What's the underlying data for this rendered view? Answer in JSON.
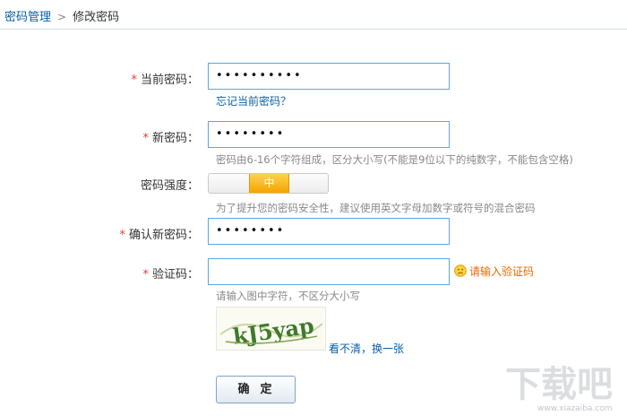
{
  "breadcrumb": {
    "parent": "密码管理",
    "current": "修改密码"
  },
  "form": {
    "current_password": {
      "label": "当前密码：",
      "required_mark": "*",
      "value": "••••••••••"
    },
    "forgot_link": "忘记当前密码？",
    "new_password": {
      "label": "新密码：",
      "required_mark": "*",
      "value": "••••••••",
      "hint": "密码由6-16个字符组成，区分大小写(不能是9位以下的纯数字，不能包含空格)"
    },
    "strength": {
      "label": "密码强度：",
      "level": "中",
      "hint": "为了提升您的密码安全性，建议使用英文字母加数字或符号的混合密码"
    },
    "confirm_password": {
      "label": "确认新密码：",
      "required_mark": "*",
      "value": "••••••••"
    },
    "captcha": {
      "label": "验证码：",
      "required_mark": "*",
      "value": "",
      "warning": "请输入验证码",
      "hint": "请输入图中字符，不区分大小写",
      "image_text": "kJ5yap",
      "refresh_link": "看不清，换一张"
    },
    "submit_label": "确定"
  },
  "watermark": {
    "text": "下载吧",
    "url": "www.xiazaiba.com"
  },
  "colors": {
    "link": "#0b5fa5",
    "required": "#e3393c",
    "input_border": "#5ea7d6",
    "strength_mid": "#f5a300",
    "warning": "#e56a00"
  }
}
